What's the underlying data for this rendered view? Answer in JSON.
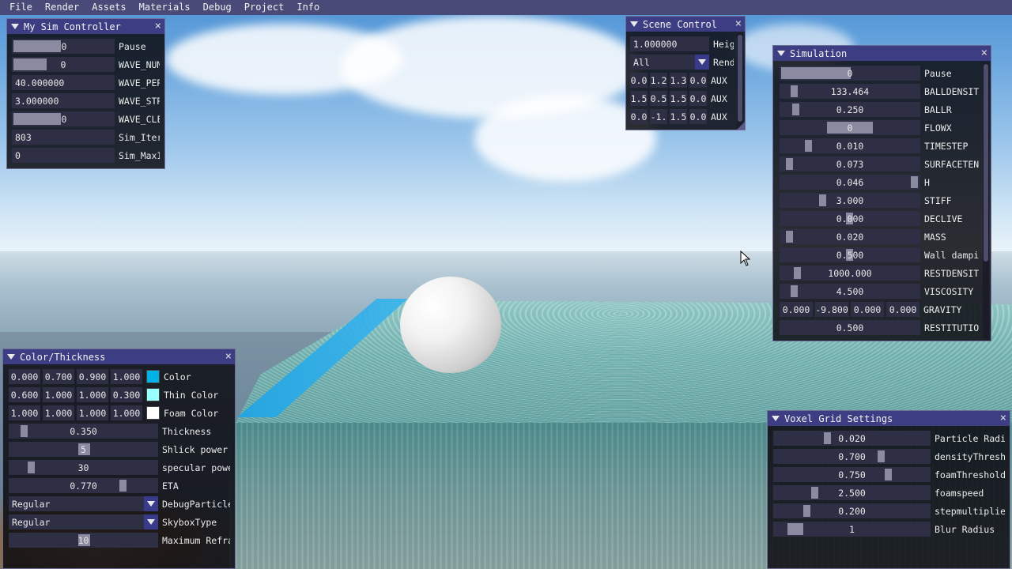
{
  "menubar": [
    "File",
    "Render",
    "Assets",
    "Materials",
    "Debug",
    "Project",
    "Info"
  ],
  "colors": {
    "menubar_bg": "#4a4a78",
    "title_bg": "#3d3d84",
    "window_bg": "#0c0c12",
    "field_bg": "#2e2e45",
    "grab": "#8a8aa0"
  },
  "my_sim": {
    "title": "My Sim Controller",
    "rows": [
      {
        "value": "0",
        "label": "Pause",
        "fill": 0.0
      },
      {
        "value": "0",
        "label": "WAVE_NUM",
        "fill": 0.0
      },
      {
        "value": "40.000000",
        "label": "WAVE_PER"
      },
      {
        "value": "3.000000",
        "label": "WAVE_STR"
      },
      {
        "value": "0",
        "label": "WAVE_CLE",
        "fill": 0.0
      },
      {
        "value": "803",
        "label": "Sim_Iter"
      },
      {
        "value": "0",
        "label": "Sim_MaxI"
      }
    ]
  },
  "scene_control": {
    "title": "Scene Control",
    "height_value": "1.000000",
    "height_label": "Heig",
    "render_value": "All",
    "render_label": "Rend",
    "aux": [
      {
        "values": [
          "0.0",
          "1.2",
          "1.3",
          "0.0"
        ],
        "label": "AUX"
      },
      {
        "values": [
          "1.5",
          "0.5",
          "1.5",
          "0.0"
        ],
        "label": "AUX"
      },
      {
        "values": [
          "0.0",
          "-1.",
          "1.5",
          "0.0"
        ],
        "label": "AUX"
      }
    ]
  },
  "simulation": {
    "title": "Simulation",
    "rows": [
      {
        "value": "0",
        "label": "Pause"
      },
      {
        "value": "133.464",
        "label": "BALLDENSIT"
      },
      {
        "value": "0.250",
        "label": "BALLR"
      },
      {
        "value": "0",
        "label": "FLOWX"
      },
      {
        "value": "0.010",
        "label": "TIMESTEP"
      },
      {
        "value": "0.073",
        "label": "SURFACETEN"
      },
      {
        "value": "0.046",
        "label": "H"
      },
      {
        "value": "3.000",
        "label": "STIFF"
      },
      {
        "value": "0.000",
        "label": "DECLIVE"
      },
      {
        "value": "0.020",
        "label": "MASS"
      },
      {
        "value": "0.500",
        "label": "Wall dampi"
      },
      {
        "value": "1000.000",
        "label": "RESTDENSIT"
      },
      {
        "value": "4.500",
        "label": "VISCOSITY"
      }
    ],
    "gravity": {
      "values": [
        "0.000",
        "-9.800",
        "0.000",
        "0.000"
      ],
      "label": "GRAVITY"
    },
    "restitution": {
      "value": "0.500",
      "label": "RESTITUTIO"
    }
  },
  "color_thickness": {
    "title": "Color/Thickness",
    "colors": [
      {
        "values": [
          "0.000",
          "0.700",
          "0.900",
          "1.000"
        ],
        "label": "Color",
        "swatch": "#00b3e6"
      },
      {
        "values": [
          "0.600",
          "1.000",
          "1.000",
          "0.300"
        ],
        "label": "Thin Color",
        "swatch": "#99ffff"
      },
      {
        "values": [
          "1.000",
          "1.000",
          "1.000",
          "1.000"
        ],
        "label": "Foam Color",
        "swatch": "#ffffff"
      }
    ],
    "sliders": [
      {
        "value": "0.350",
        "label": "Thickness"
      },
      {
        "value": "5",
        "label": "Shlick power"
      },
      {
        "value": "30",
        "label": "specular powe"
      },
      {
        "value": "0.770",
        "label": "ETA"
      }
    ],
    "combos": [
      {
        "value": "Regular",
        "label": "DebugParticle"
      },
      {
        "value": "Regular",
        "label": "SkyboxType"
      }
    ],
    "max_refra": {
      "value": "10",
      "label": "Maximum Refra"
    }
  },
  "voxel": {
    "title": "Voxel Grid Settings",
    "rows": [
      {
        "value": "0.020",
        "label": "Particle Radi"
      },
      {
        "value": "0.700",
        "label": "densityThresh"
      },
      {
        "value": "0.750",
        "label": "foamThreshold"
      },
      {
        "value": "2.500",
        "label": "foamspeed"
      },
      {
        "value": "0.200",
        "label": "stepmultiplie"
      },
      {
        "value": "1",
        "label": "Blur Radius"
      }
    ]
  }
}
